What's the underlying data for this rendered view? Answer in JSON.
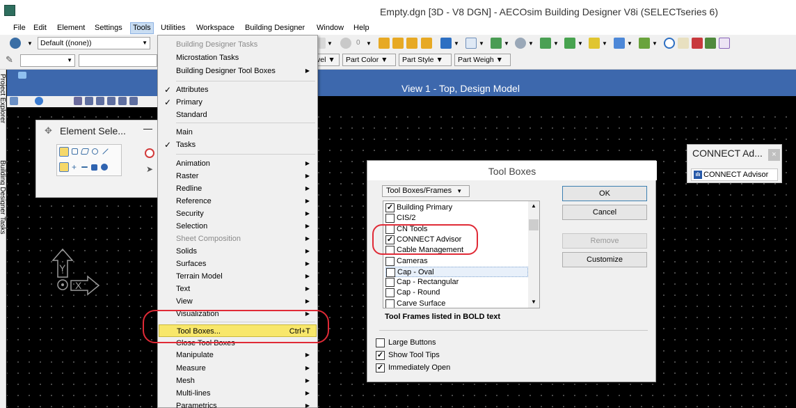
{
  "window": {
    "title": "Empty.dgn [3D - V8 DGN] - AECOsim Building Designer V8i (SELECTseries 6)"
  },
  "menubar": [
    "File",
    "Edit",
    "Element",
    "Settings",
    "Tools",
    "Utilities",
    "Workspace",
    "Building Designer",
    "Window",
    "Help"
  ],
  "toolbar": {
    "level_combo": "Default ((none))",
    "attr_buttons": [
      "vel",
      "Part Color",
      "Part Style",
      "Part Weigh"
    ],
    "transparency_value": "0"
  },
  "side_tabs": [
    "Project Explorer",
    "Building Designer Tasks"
  ],
  "view": {
    "title": "View 1 - Top, Design Model"
  },
  "element_selection": {
    "title": "Element Sele...",
    "min": "—",
    "max": "☐"
  },
  "connect_advisor": {
    "title": "CONNECT Ad...",
    "close": "×",
    "button_label": "CONNECT Advisor"
  },
  "tools_menu": {
    "items": [
      {
        "label": "Building Designer Tasks",
        "disabled": true
      },
      {
        "label": "Microstation Tasks",
        "disabled": false
      },
      {
        "label": "Building Designer Tool Boxes",
        "submenu": true
      },
      {
        "label": "Attributes",
        "checked": true
      },
      {
        "label": "Primary",
        "checked": true
      },
      {
        "label": "Standard"
      },
      {
        "label": "Main"
      },
      {
        "label": "Tasks",
        "checked": true
      },
      {
        "label": "Animation",
        "submenu": true
      },
      {
        "label": "Raster",
        "submenu": true
      },
      {
        "label": "Redline",
        "submenu": true
      },
      {
        "label": "Reference",
        "submenu": true
      },
      {
        "label": "Security",
        "submenu": true
      },
      {
        "label": "Selection",
        "submenu": true
      },
      {
        "label": "Sheet Composition",
        "submenu": true,
        "disabled": true
      },
      {
        "label": "Solids",
        "submenu": true
      },
      {
        "label": "Surfaces",
        "submenu": true
      },
      {
        "label": "Terrain Model",
        "submenu": true
      },
      {
        "label": "Text",
        "submenu": true
      },
      {
        "label": "View",
        "submenu": true
      },
      {
        "label": "Visualization",
        "submenu": true
      },
      {
        "label": "Tool Boxes...",
        "shortcut": "Ctrl+T",
        "highlighted": true
      },
      {
        "label": "Close Tool Boxes"
      },
      {
        "label": "Manipulate",
        "submenu": true
      },
      {
        "label": "Measure",
        "submenu": true
      },
      {
        "label": "Mesh",
        "submenu": true
      },
      {
        "label": "Multi-lines",
        "submenu": true
      },
      {
        "label": "Parametrics",
        "submenu": true
      }
    ]
  },
  "dialog": {
    "title": "Tool Boxes",
    "filter": "Tool Boxes/Frames",
    "list": [
      {
        "label": "Building Primary",
        "checked": true
      },
      {
        "label": "CIS/2",
        "checked": false
      },
      {
        "label": "CN Tools",
        "checked": false
      },
      {
        "label": "CONNECT Advisor",
        "checked": true
      },
      {
        "label": "Cable Management",
        "checked": false
      },
      {
        "label": "Cameras",
        "checked": false
      },
      {
        "label": "Cap - Oval",
        "checked": false,
        "selected": true
      },
      {
        "label": "Cap - Rectangular",
        "checked": false
      },
      {
        "label": "Cap - Round",
        "checked": false
      },
      {
        "label": "Carve Surface",
        "checked": false
      }
    ],
    "buttons": {
      "ok": "OK",
      "cancel": "Cancel",
      "remove": "Remove",
      "customize": "Customize"
    },
    "note": "Tool Frames listed in BOLD text",
    "options": [
      {
        "label": "Large Buttons",
        "checked": false
      },
      {
        "label": "Show Tool Tips",
        "checked": true
      },
      {
        "label": "Immediately Open",
        "checked": true
      }
    ]
  },
  "colors": {
    "view_title_bar": "#3d68ad",
    "highlight": "#f8e76a",
    "annotation": "#e02a36"
  }
}
